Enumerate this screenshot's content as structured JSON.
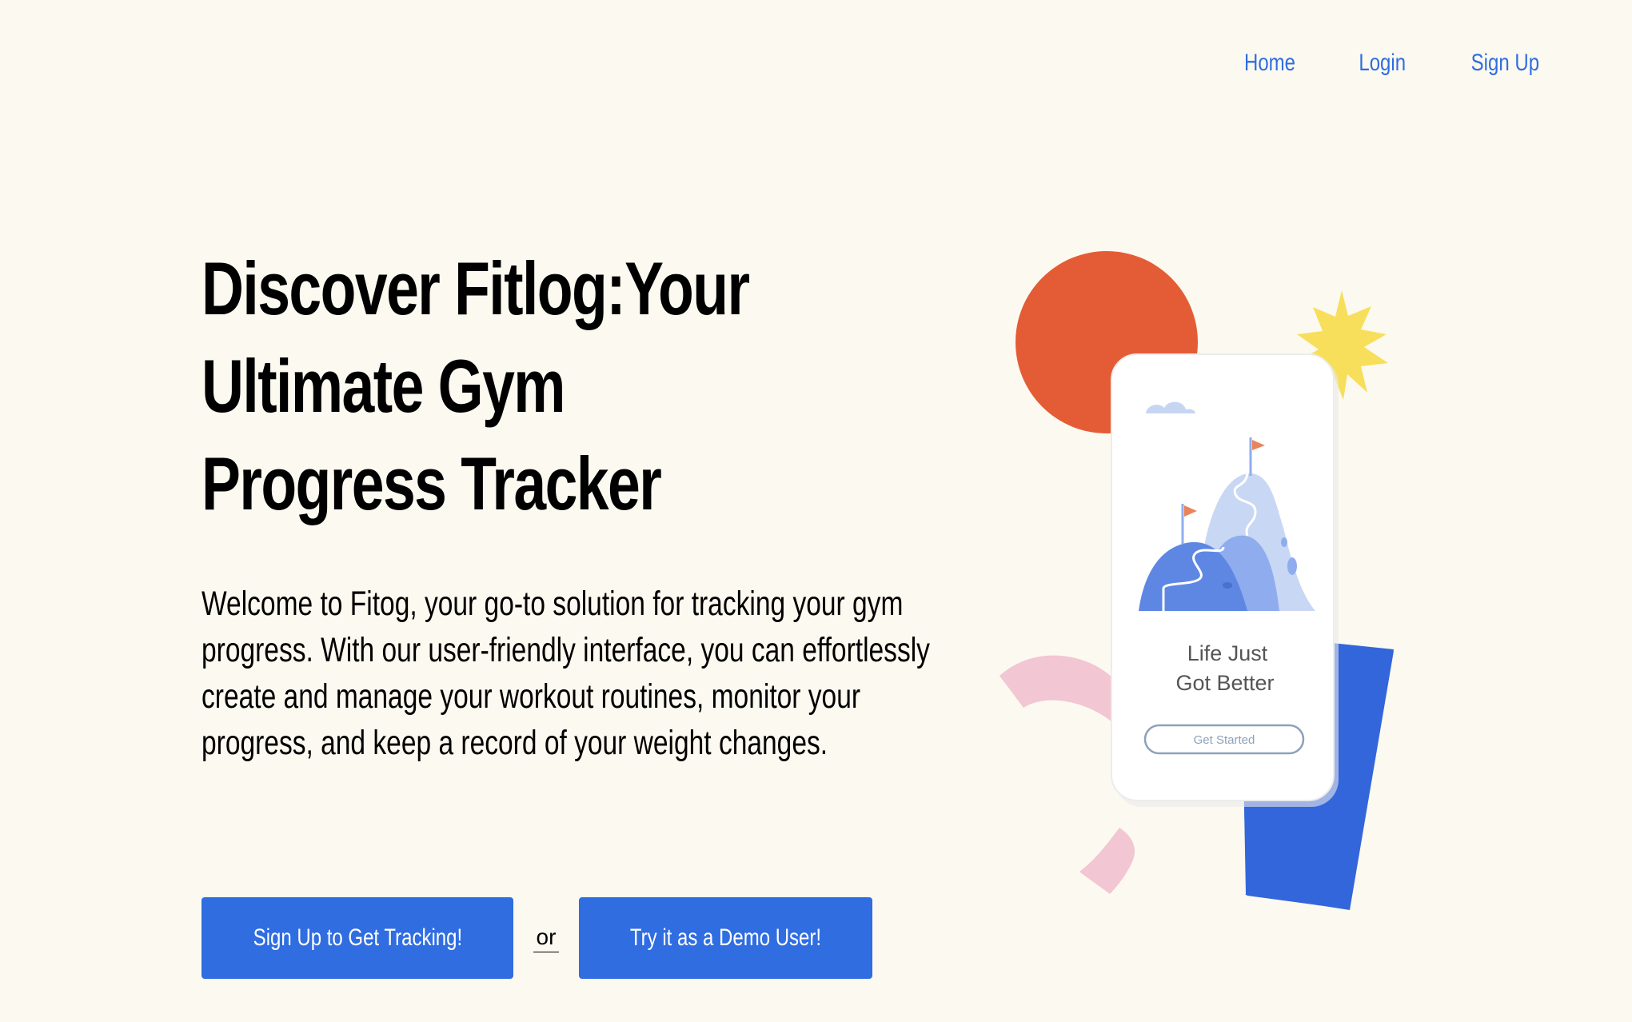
{
  "nav": {
    "home": "Home",
    "login": "Login",
    "signup": "Sign Up"
  },
  "hero": {
    "title": "Discover Fitlog:Your\nUltimate Gym\nProgress Tracker",
    "description": "Welcome to Fitog, your go-to solution for tracking your gym progress. With our user-friendly interface, you can effortlessly create and manage your workout routines, monitor your progress, and keep a record of your weight changes."
  },
  "cta": {
    "signup_label": "Sign Up to Get Tracking!",
    "or_label": "or",
    "demo_label": "Try it as a Demo User!"
  },
  "phone": {
    "tagline_line1": "Life Just",
    "tagline_line2": "Got Better",
    "button_label": "Get Started"
  },
  "colors": {
    "background": "#fcf9f0",
    "accent_blue": "#2f6de1",
    "orange": "#e45c35",
    "yellow": "#f7df5b",
    "pink": "#f2c6d3",
    "deep_blue": "#3366db"
  }
}
